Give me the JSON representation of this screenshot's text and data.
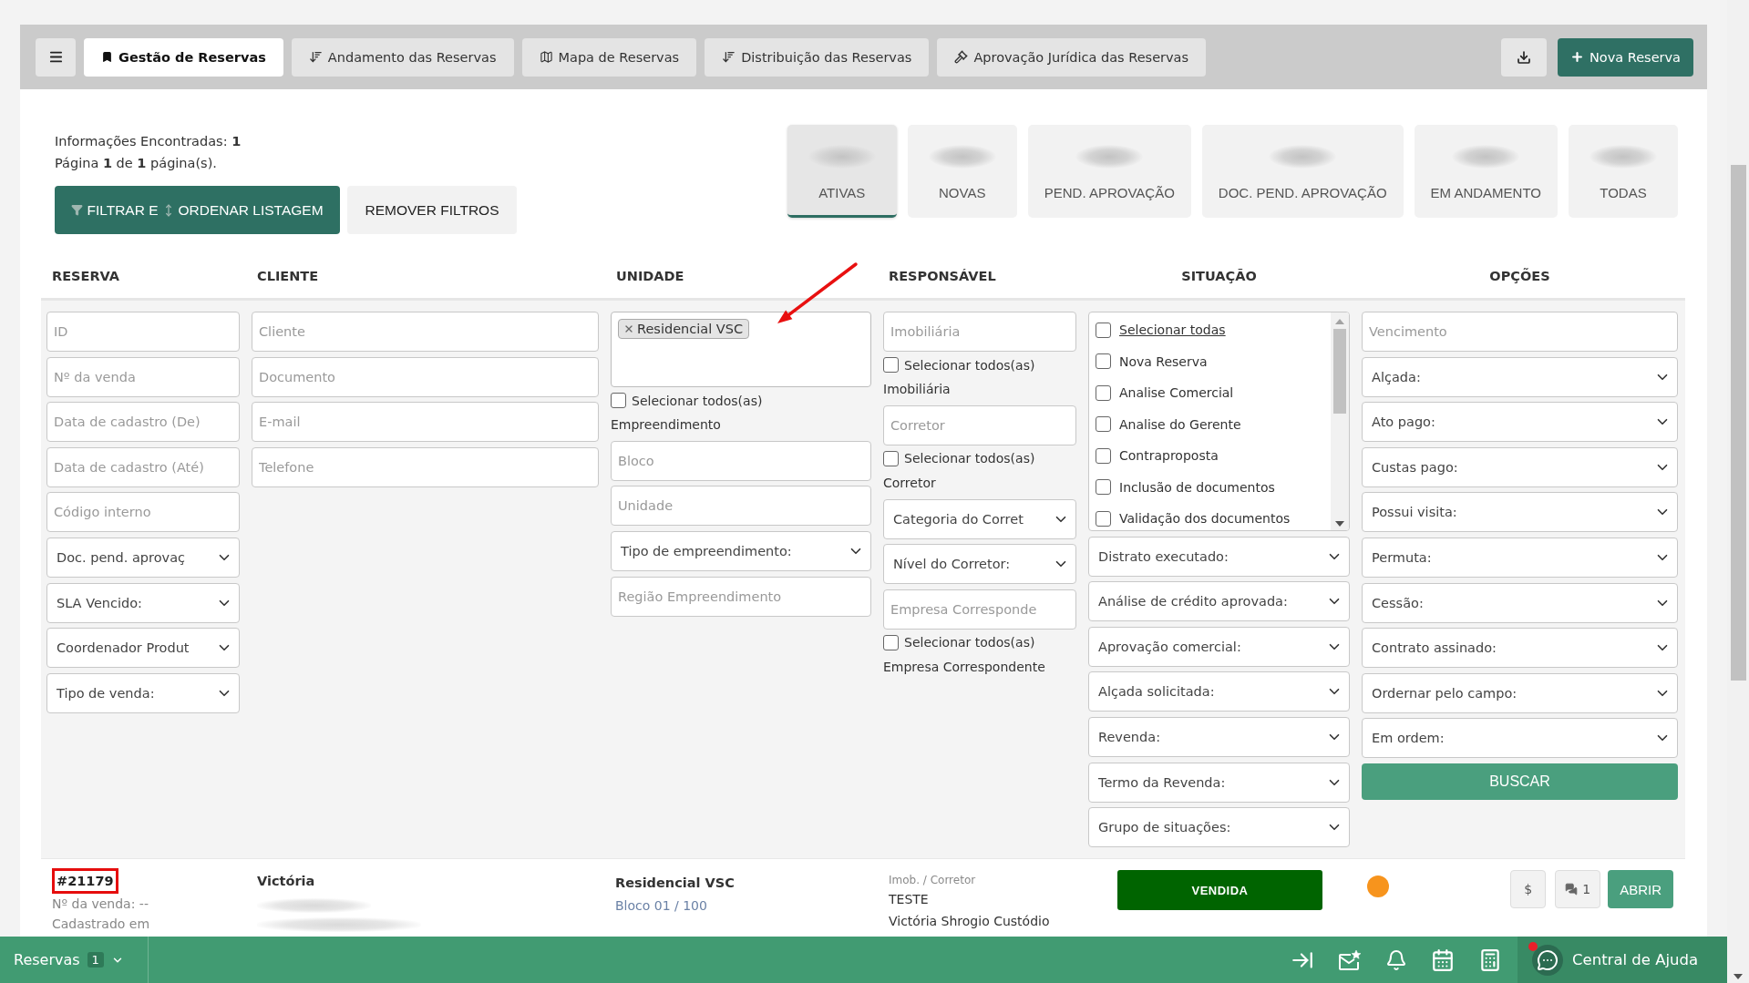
{
  "nav": {
    "tabs": [
      {
        "label": "Gestão de Reservas",
        "selected": true
      },
      {
        "label": "Andamento das Reservas",
        "selected": false
      },
      {
        "label": "Mapa de Reservas",
        "selected": false
      },
      {
        "label": "Distribuição das Reservas",
        "selected": false
      },
      {
        "label": "Aprovação Jurídica das Reservas",
        "selected": false
      }
    ],
    "new_button": "Nova Reserva"
  },
  "summary": {
    "found": "Informações Encontradas: **1**",
    "page": "Página **1** de **1** página(s)."
  },
  "filter_button": {
    "label_start": "FILTRAR E",
    "label_end": "ORDENAR LISTAGEM"
  },
  "remove_filters_button": "REMOVER FILTROS",
  "status_cards": [
    {
      "label": "ATIVAS",
      "selected": true
    },
    {
      "label": "NOVAS",
      "selected": false
    },
    {
      "label": "PEND. APROVAÇÃO",
      "selected": false
    },
    {
      "label": "DOC. PEND. APROVAÇÃO",
      "selected": false
    },
    {
      "label": "EM ANDAMENTO",
      "selected": false
    },
    {
      "label": "TODAS",
      "selected": false
    }
  ],
  "columns": [
    "RESERVA",
    "CLIENTE",
    "UNIDADE",
    "RESPONSÁVEL",
    "SITUAÇÃO",
    "OPÇÕES"
  ],
  "filters": [
    [
      {
        "kind": "input",
        "placeholder": "ID"
      },
      {
        "kind": "input",
        "placeholder": "Nº da venda"
      },
      {
        "kind": "input",
        "placeholder": "Data de cadastro (De)"
      },
      {
        "kind": "input",
        "placeholder": "Data de cadastro (Até)"
      },
      {
        "kind": "input",
        "placeholder": "Código interno"
      },
      {
        "kind": "select",
        "value": "Doc. pend. aprovaç"
      },
      {
        "kind": "select",
        "value": "SLA Vencido:"
      },
      {
        "kind": "select",
        "value": "Coordenador Produt"
      },
      {
        "kind": "select",
        "value": "Tipo de venda:"
      }
    ],
    [
      {
        "kind": "input",
        "placeholder": "Cliente"
      },
      {
        "kind": "input",
        "placeholder": "Documento"
      },
      {
        "kind": "input",
        "placeholder": "E-mail"
      },
      {
        "kind": "input",
        "placeholder": "Telefone"
      }
    ],
    [
      {
        "kind": "tags",
        "tags": [
          "Residencial VSC"
        ]
      },
      {
        "kind": "checkbox",
        "label": "Selecionar todos(as)",
        "checked": false
      },
      {
        "kind": "caption",
        "text": "Empreendimento"
      },
      {
        "kind": "input",
        "placeholder": "Bloco"
      },
      {
        "kind": "input",
        "placeholder": "Unidade"
      },
      {
        "kind": "select",
        "value": "Tipo de empreendimento:"
      },
      {
        "kind": "input",
        "placeholder": "Região Empreendimento"
      }
    ],
    [
      {
        "kind": "input",
        "placeholder": "Imobiliária"
      },
      {
        "kind": "checkbox",
        "label": "Selecionar todos(as)",
        "checked": false
      },
      {
        "kind": "caption",
        "text": "Imobiliária"
      },
      {
        "kind": "input",
        "placeholder": "Corretor"
      },
      {
        "kind": "checkbox",
        "label": "Selecionar todos(as)",
        "checked": false
      },
      {
        "kind": "caption",
        "text": "Corretor"
      },
      {
        "kind": "select",
        "value": "Categoria do Corret"
      },
      {
        "kind": "select",
        "value": "Nível do Corretor:"
      },
      {
        "kind": "input",
        "placeholder": "Empresa Corresponde"
      },
      {
        "kind": "checkbox",
        "label": "Selecionar todos(as)",
        "checked": false
      },
      {
        "kind": "caption",
        "text": "Empresa Correspondente"
      }
    ],
    [
      {
        "kind": "checklist",
        "items": [
          {
            "kind": "link",
            "label": "Selecionar todas",
            "checked": false
          },
          {
            "kind": "option",
            "label": "Nova Reserva",
            "checked": false
          },
          {
            "kind": "option",
            "label": "Analise Comercial",
            "checked": false
          },
          {
            "kind": "option",
            "label": "Analise do Gerente",
            "checked": false
          },
          {
            "kind": "option",
            "label": "Contraproposta",
            "checked": false
          },
          {
            "kind": "option",
            "label": "Inclusão de documentos",
            "checked": false
          },
          {
            "kind": "option",
            "label": "Validação dos documentos",
            "checked": false
          }
        ]
      },
      {
        "kind": "select",
        "value": "Distrato executado:"
      },
      {
        "kind": "select",
        "value": "Análise de crédito aprovada:"
      },
      {
        "kind": "select",
        "value": "Aprovação comercial:"
      },
      {
        "kind": "select",
        "value": "Alçada solicitada:"
      },
      {
        "kind": "select",
        "value": "Revenda:"
      },
      {
        "kind": "select",
        "value": "Termo da Revenda:"
      },
      {
        "kind": "select",
        "value": "Grupo de situações:"
      }
    ],
    [
      {
        "kind": "input",
        "placeholder": "Vencimento"
      },
      {
        "kind": "select",
        "value": "Alçada:"
      },
      {
        "kind": "select",
        "value": "Ato pago:"
      },
      {
        "kind": "select",
        "value": "Custas pago:"
      },
      {
        "kind": "select",
        "value": "Possui visita:"
      },
      {
        "kind": "select",
        "value": "Permuta:"
      },
      {
        "kind": "select",
        "value": "Cessão:"
      },
      {
        "kind": "select",
        "value": "Contrato assinado:"
      },
      {
        "kind": "select",
        "value": "Ordernar pelo campo:"
      },
      {
        "kind": "select",
        "value": "Em ordem:"
      },
      {
        "kind": "button",
        "label": "BUSCAR"
      }
    ]
  ],
  "reservations": [
    {
      "id": "#21179",
      "sale": "Nº da venda: --",
      "registered": "Cadastrado em",
      "client": "Victória",
      "unit": "Residencial VSC",
      "block": "Bloco 01 / 100",
      "responsible_caption": "Imob. / Corretor",
      "agency": "TESTE",
      "broker": "Victória Shrogio Custódio",
      "status": "VENDIDA",
      "color": "#f7941d",
      "price_button": "$",
      "comments": "1",
      "open_button": "ABRIR"
    }
  ],
  "bottom_bar": {
    "module": "Reservas",
    "count": "1",
    "help": "Central de Ajuda"
  }
}
